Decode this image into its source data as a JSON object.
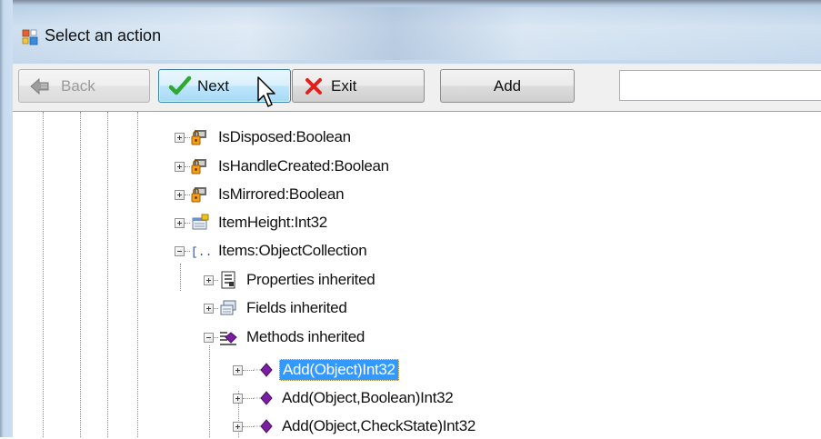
{
  "window": {
    "title": "Select an action"
  },
  "toolbar": {
    "back_label": "Back",
    "next_label": "Next",
    "exit_label": "Exit",
    "add_label": "Add",
    "search_value": ""
  },
  "tree": {
    "items": [
      {
        "label": "IsDisposed:Boolean",
        "icon": "property-lock-icon",
        "expander": "plus",
        "selected": false
      },
      {
        "label": "IsHandleCreated:Boolean",
        "icon": "property-lock-icon",
        "expander": "plus",
        "selected": false
      },
      {
        "label": "IsMirrored:Boolean",
        "icon": "property-lock-icon",
        "expander": "plus",
        "selected": false
      },
      {
        "label": "ItemHeight:Int32",
        "icon": "property-icon",
        "expander": "plus",
        "selected": false
      },
      {
        "label": "Items:ObjectCollection",
        "icon": "collection-icon",
        "expander": "minus",
        "selected": false
      },
      {
        "label": "Properties inherited",
        "icon": "properties-list-icon",
        "expander": "plus",
        "selected": false
      },
      {
        "label": "Fields inherited",
        "icon": "fields-icon",
        "expander": "plus",
        "selected": false
      },
      {
        "label": "Methods inherited",
        "icon": "methods-icon",
        "expander": "minus",
        "selected": false
      },
      {
        "label": "Add(Object)Int32",
        "icon": "method-icon",
        "expander": "plus",
        "selected": true
      },
      {
        "label": "Add(Object,Boolean)Int32",
        "icon": "method-icon",
        "expander": "plus",
        "selected": false
      },
      {
        "label": "Add(Object,CheckState)Int32",
        "icon": "method-icon",
        "expander": "plus",
        "selected": false
      }
    ]
  },
  "colors": {
    "selection": "#3399ff",
    "next_hover": "#bee6fd",
    "exit_x": "#e0201a",
    "check_green": "#2fa82f",
    "method_purple": "#7b1fa2"
  }
}
